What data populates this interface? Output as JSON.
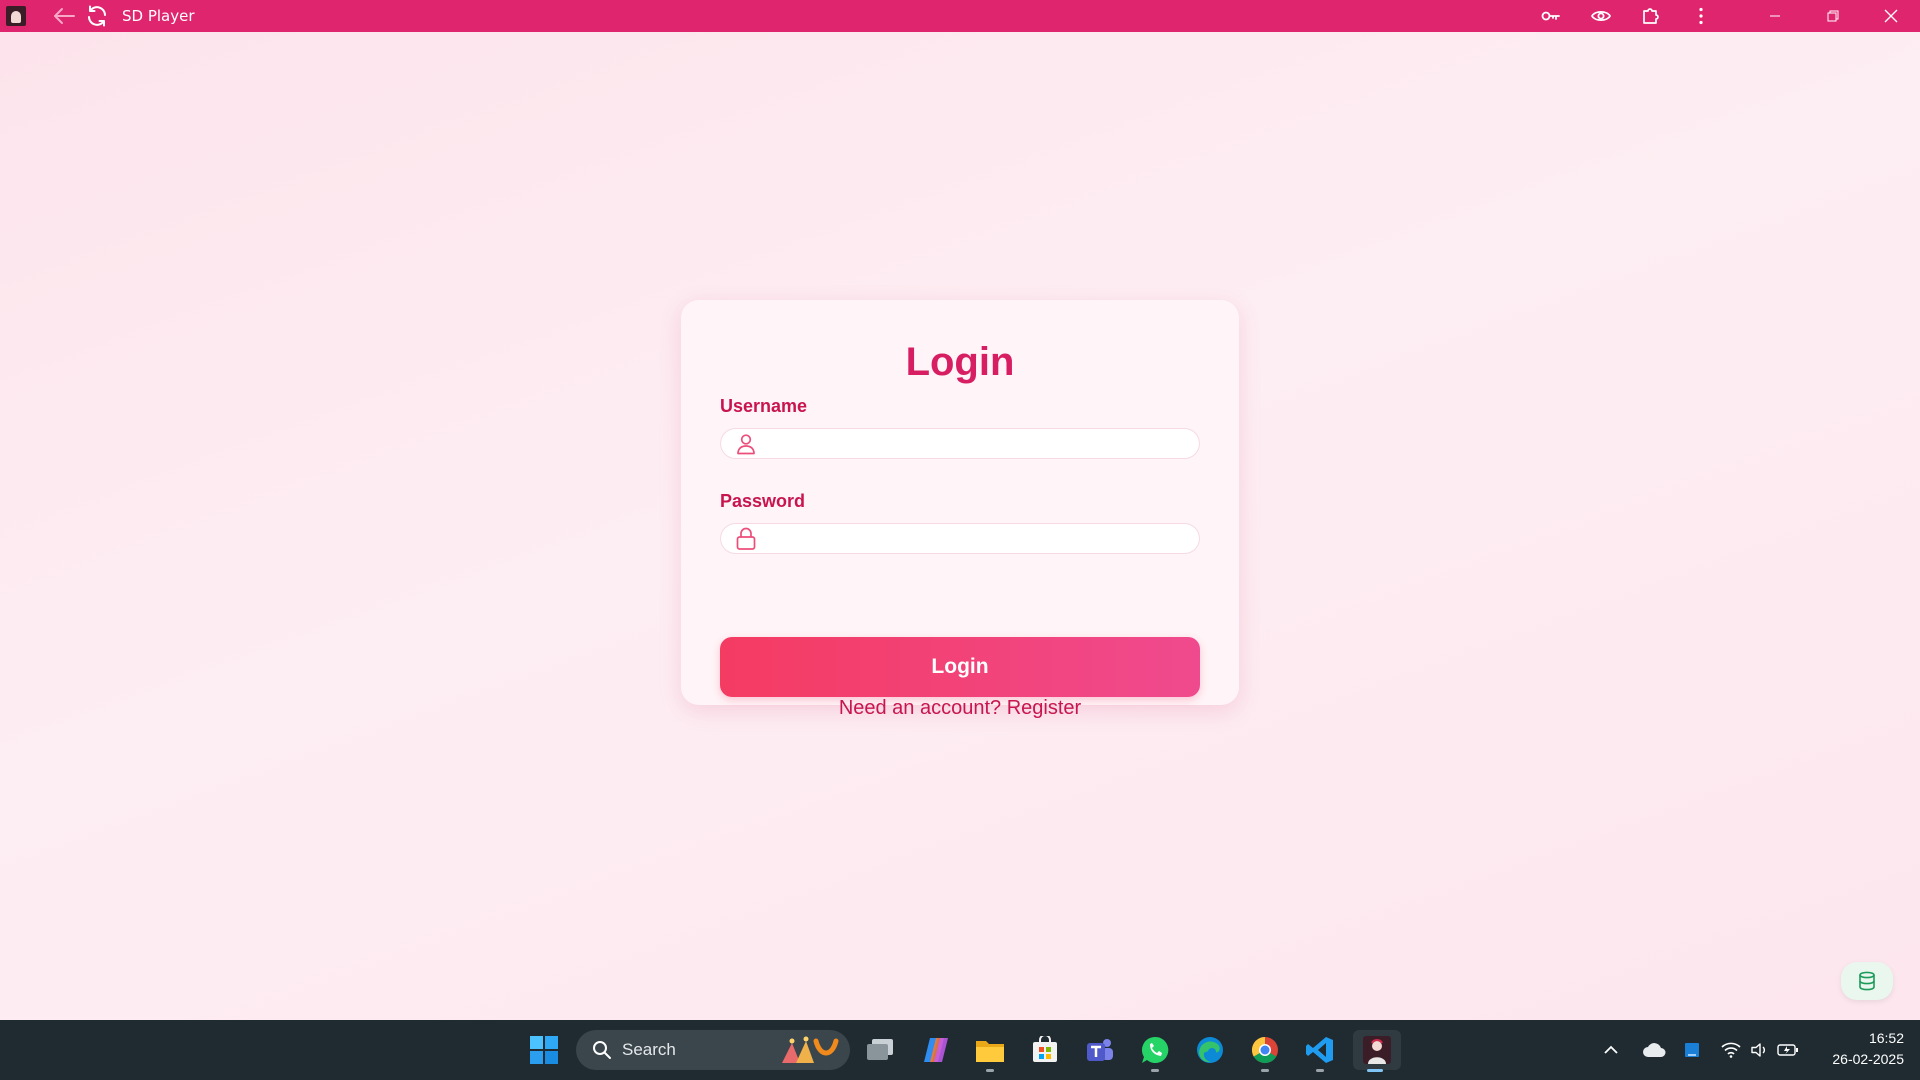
{
  "window": {
    "title": "SD Player"
  },
  "login": {
    "title": "Login",
    "username_label": "Username",
    "username_value": "",
    "password_label": "Password",
    "password_value": "",
    "submit_label": "Login",
    "register_text": "Need an account? Register"
  },
  "taskbar": {
    "search_placeholder": "Search",
    "time": "16:52",
    "date": "26-02-2025",
    "pinned_apps": [
      "start-icon",
      "task-view-icon",
      "copilot-icon",
      "file-explorer-icon",
      "microsoft-store-icon",
      "teams-icon",
      "whatsapp-icon",
      "edge-icon",
      "chrome-icon",
      "vscode-icon",
      "sd-player-icon"
    ]
  },
  "colors": {
    "titlebar": "#e0256f",
    "accent": "#d81e63",
    "button_start": "#f43b62",
    "button_end": "#f04a8e",
    "background": "#fde6ee",
    "taskbar": "#1f2b31"
  }
}
